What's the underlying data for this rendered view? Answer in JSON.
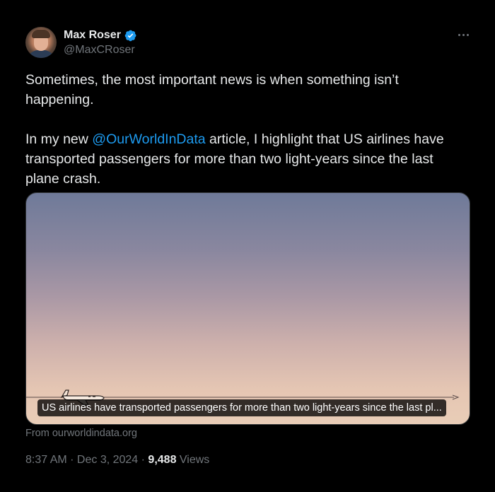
{
  "author": {
    "display_name": "Max Roser",
    "handle": "@MaxCRoser",
    "verified": true,
    "verified_color": "#1d9bf0"
  },
  "tweet": {
    "paragraph1": "Sometimes, the most important news is when something isn’t happening.",
    "paragraph2_prefix": "In my new ",
    "mention": "@OurWorldInData",
    "paragraph2_suffix": " article, I highlight that US airlines have transported passengers for more than two light-years since the last plane crash."
  },
  "media": {
    "caption": "US airlines have transported passengers for more than two light-years since the last pl...",
    "icon": "airplane-icon"
  },
  "link_source": "From ourworldindata.org",
  "meta": {
    "time": "8:37 AM",
    "separator1": " · ",
    "date": "Dec 3, 2024",
    "separator2": " · ",
    "views_count": "9,488",
    "views_label": " Views"
  },
  "icons": {
    "more": "more-options-icon",
    "verified": "verified-badge-icon"
  },
  "colors": {
    "background": "#000000",
    "text": "#e7e9ea",
    "muted": "#71767b",
    "accent": "#1d9bf0"
  }
}
